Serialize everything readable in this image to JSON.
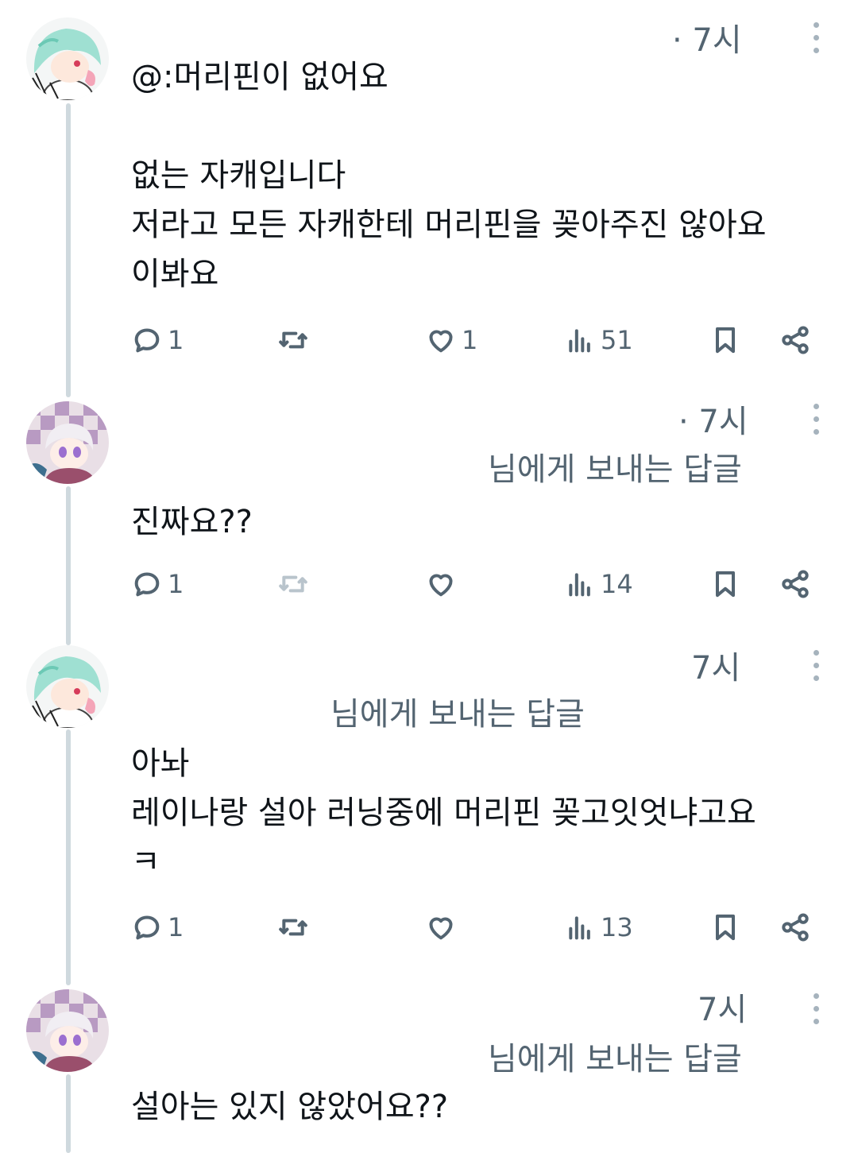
{
  "tweets": [
    {
      "time": "· 7시",
      "reply_to": "",
      "text": "@:머리핀이 없어요\n\n없는 자캐입니다\n저라고 모든 자캐한테 머리핀을 꽂아주진 않아요\n이봐요",
      "replies": "1",
      "retweets": "",
      "likes": "1",
      "views": "51"
    },
    {
      "time": "· 7시",
      "reply_to": "님에게 보내는 답글",
      "text": "진짜요??",
      "replies": "1",
      "retweets": "",
      "likes": "",
      "views": "14"
    },
    {
      "time": "7시",
      "reply_to": "님에게 보내는 답글",
      "text": "아놔\n레이나랑 설아 러닝중에 머리핀 꽂고잇엇냐고요\nㅋ",
      "replies": "1",
      "retweets": "",
      "likes": "",
      "views": "13"
    },
    {
      "time": "7시",
      "reply_to": "님에게 보내는 답글",
      "text": "설아는 있지 않았어요??",
      "replies": "",
      "retweets": "",
      "likes": "",
      "views": ""
    }
  ],
  "icons": {
    "reply": "speech-bubble-icon",
    "retweet": "retweet-arrows-icon",
    "like": "heart-icon",
    "views": "bar-chart-icon",
    "bookmark": "bookmark-icon",
    "share": "share-nodes-icon",
    "more": "vertical-ellipsis-icon"
  },
  "colors": {
    "text": "#0f1419",
    "secondary": "#536471",
    "thread_line": "#cfd9de",
    "disabled_icon": "#b9c4cc"
  }
}
